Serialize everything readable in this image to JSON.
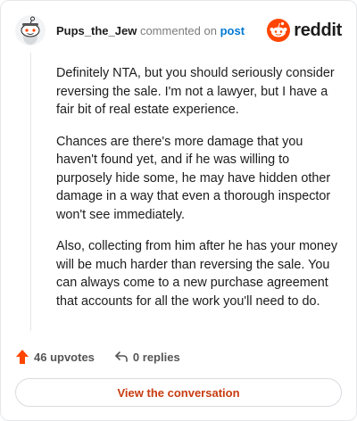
{
  "comment": {
    "username": "Pups_the_Jew",
    "action_text": "commented on",
    "post_link": "post",
    "paragraphs": [
      "Definitely NTA, but you should seriously consider reversing the sale. I'm not a lawyer, but I have a fair bit of real estate experience.",
      "Chances are there's more damage that you haven't found yet, and if he was willing to purposely hide some, he may have hidden other damage in a way that even a thorough inspector won't see immediately.",
      "Also, collecting from him after he has your money will be much harder than reversing the sale. You can always come to a new purchase agreement that accounts for all the work you'll need to do."
    ]
  },
  "brand": {
    "name": "reddit",
    "color": "#ff4500"
  },
  "actions": {
    "upvotes": "46 upvotes",
    "replies": "0 replies",
    "upvote_color": "#ff4500"
  },
  "cta": {
    "label": "View the conversation"
  },
  "icons": {
    "avatar": "snoo-avatar-icon",
    "logo": "reddit-logo-icon",
    "upvote": "upvote-arrow-icon",
    "reply": "reply-arrow-icon"
  }
}
